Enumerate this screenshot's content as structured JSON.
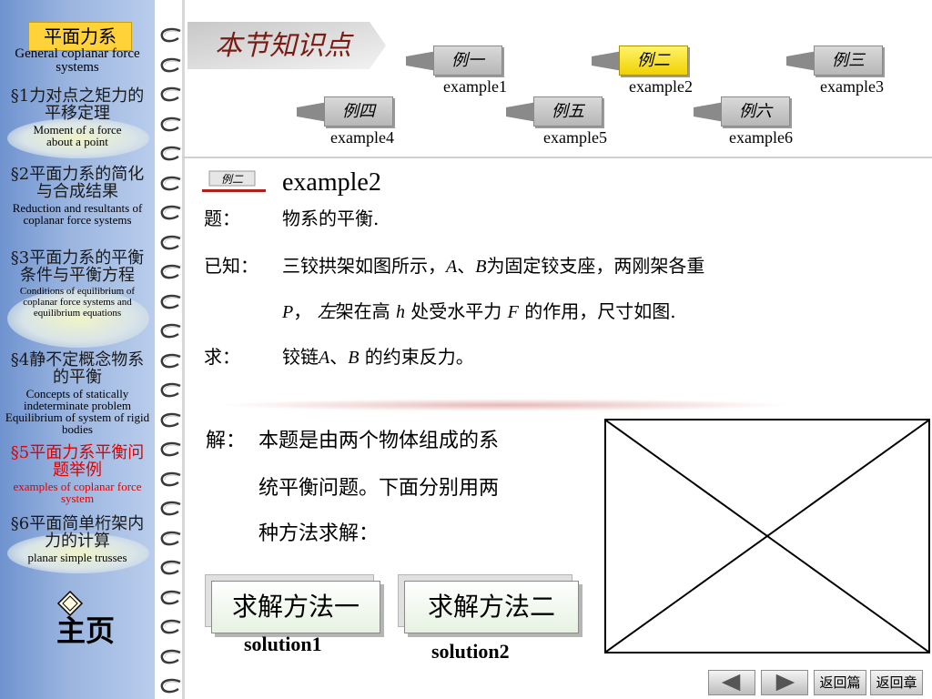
{
  "sidebar": {
    "title": "平面力系",
    "title_en": "General coplanar force systems",
    "items": [
      {
        "cn": "§1力对点之矩力的平移定理",
        "en": "Moment of a force about a point",
        "active": false
      },
      {
        "cn": "§2平面力系的简化与合成结果",
        "en": "Reduction and resultants of coplanar force systems",
        "active": false
      },
      {
        "cn": "§3平面力系的平衡条件与平衡方程",
        "en": "Conditions of equilibrium of coplanar force systems and equilibrium equations",
        "active": false
      },
      {
        "cn": "§4静不定概念物系的平衡",
        "en": "Concepts of statically indeterminate problem Equilibrium of system of rigid bodies",
        "active": false
      },
      {
        "cn": "§5平面力系平衡问题举例",
        "en": "examples of coplanar force system",
        "active": true
      },
      {
        "cn": "§6平面简单桁架内力的计算",
        "en": "planar simple trusses",
        "active": false
      }
    ],
    "home_label": "主页"
  },
  "header": {
    "logo_text": "本节知识点",
    "examples": [
      {
        "cn": "例一",
        "en": "example1",
        "active": false
      },
      {
        "cn": "例二",
        "en": "example2",
        "active": true
      },
      {
        "cn": "例三",
        "en": "example3",
        "active": false
      },
      {
        "cn": "例四",
        "en": "example4",
        "active": false
      },
      {
        "cn": "例五",
        "en": "example5",
        "active": false
      },
      {
        "cn": "例六",
        "en": "example6",
        "active": false
      }
    ]
  },
  "problem": {
    "icon_text": "例二",
    "title": "example2",
    "q_label": "题：",
    "q_text": "物系的平衡.",
    "given_label": "已知：",
    "given_line1_a": "三铰拱架如图所示，",
    "given_line1_A": "A",
    "given_line1_sep": "、",
    "given_line1_B": "B",
    "given_line1_b": "为固定铰支座，两刚架各重",
    "given_line2_P": "P",
    "given_line2_a": "，",
    "given_line2_b": "左",
    "given_line2_c": "架在高",
    "given_line2_h": "h",
    "given_line2_d": "处受水平力",
    "given_line2_F": "F",
    "given_line2_e": "的作用，尺寸如图.",
    "find_label": "求：",
    "find_a": "铰链",
    "find_A": "A",
    "find_sep": "、",
    "find_B": "B",
    "find_b": "的约束反力。"
  },
  "solution": {
    "label": "解：",
    "lines": [
      "本题是由两个物体组成的系",
      "统平衡问题。下面分别用两",
      "种方法求解："
    ],
    "method1": "求解方法一",
    "method1_en": "solution1",
    "method2": "求解方法二",
    "method2_en": "solution2"
  },
  "bottom_nav": {
    "return_chapter": "返回篇",
    "return_section": "返回章"
  },
  "colors": {
    "sidebar": "#9bb5e0",
    "active_text": "#e00000",
    "active_button": "#f0d200"
  }
}
